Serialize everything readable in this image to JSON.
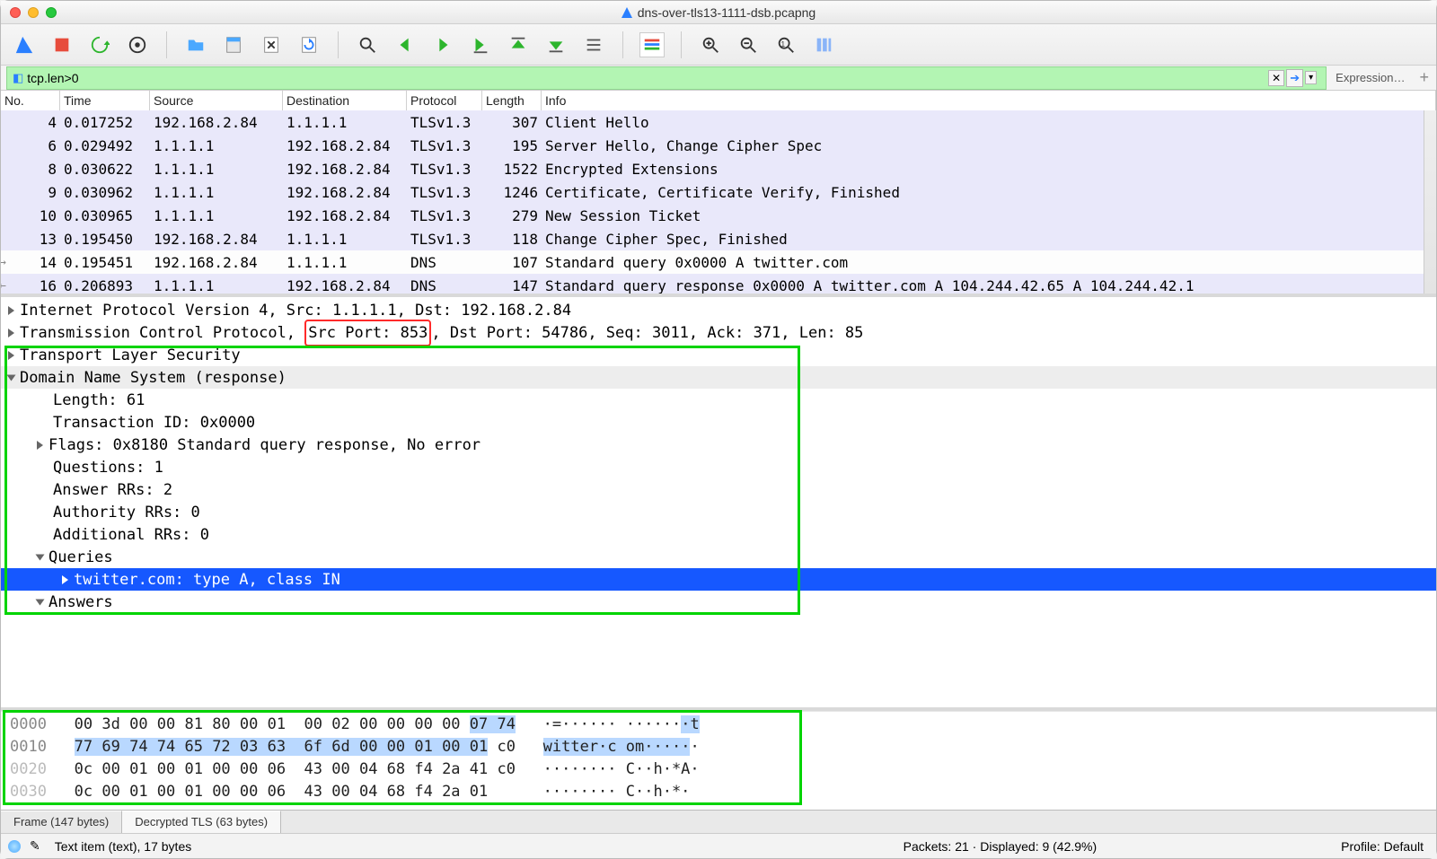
{
  "title": "dns-over-tls13-1111-dsb.pcapng",
  "filter": {
    "value": "tcp.len>0",
    "expression_label": "Expression…"
  },
  "packet_list": {
    "headers": [
      "No.",
      "Time",
      "Source",
      "Destination",
      "Protocol",
      "Length",
      "Info"
    ],
    "rows": [
      {
        "no": "4",
        "time": "0.017252",
        "src": "192.168.2.84",
        "dst": "1.1.1.1",
        "proto": "TLSv1.3",
        "len": "307",
        "info": "Client Hello",
        "cls": ""
      },
      {
        "no": "6",
        "time": "0.029492",
        "src": "1.1.1.1",
        "dst": "192.168.2.84",
        "proto": "TLSv1.3",
        "len": "195",
        "info": "Server Hello, Change Cipher Spec",
        "cls": ""
      },
      {
        "no": "8",
        "time": "0.030622",
        "src": "1.1.1.1",
        "dst": "192.168.2.84",
        "proto": "TLSv1.3",
        "len": "1522",
        "info": "Encrypted Extensions",
        "cls": ""
      },
      {
        "no": "9",
        "time": "0.030962",
        "src": "1.1.1.1",
        "dst": "192.168.2.84",
        "proto": "TLSv1.3",
        "len": "1246",
        "info": "Certificate, Certificate Verify, Finished",
        "cls": ""
      },
      {
        "no": "10",
        "time": "0.030965",
        "src": "1.1.1.1",
        "dst": "192.168.2.84",
        "proto": "TLSv1.3",
        "len": "279",
        "info": "New Session Ticket",
        "cls": ""
      },
      {
        "no": "13",
        "time": "0.195450",
        "src": "192.168.2.84",
        "dst": "1.1.1.1",
        "proto": "TLSv1.3",
        "len": "118",
        "info": "Change Cipher Spec, Finished",
        "cls": ""
      },
      {
        "no": "14",
        "time": "0.195451",
        "src": "192.168.2.84",
        "dst": "1.1.1.1",
        "proto": "DNS",
        "len": "107",
        "info": "Standard query 0x0000 A twitter.com",
        "cls": "white",
        "mark": "→"
      },
      {
        "no": "16",
        "time": "0.206893",
        "src": "1.1.1.1",
        "dst": "192.168.2.84",
        "proto": "DNS",
        "len": "147",
        "info": "Standard query response 0x0000 A twitter.com A 104.244.42.65 A 104.244.42.1",
        "cls": "",
        "mark": "←"
      }
    ]
  },
  "details": {
    "ip_line": "Internet Protocol Version 4, Src: 1.1.1.1, Dst: 192.168.2.84",
    "tcp_pre": "Transmission Control Protocol, ",
    "tcp_hl": "Src Port: 853",
    "tcp_post": ", Dst Port: 54786, Seq: 3011, Ack: 371, Len: 85",
    "tls_line": "Transport Layer Security",
    "dns_line": "Domain Name System (response)",
    "len": "Length: 61",
    "txid": "Transaction ID: 0x0000",
    "flags": "Flags: 0x8180 Standard query response, No error",
    "q": "Questions: 1",
    "arr": "Answer RRs: 2",
    "aurr": "Authority RRs: 0",
    "adrr": "Additional RRs: 0",
    "queries": "Queries",
    "query1": "twitter.com: type A, class IN",
    "answers": "Answers"
  },
  "bytes": {
    "0000": {
      "addr": "0000",
      "pre": "00 3d 00 00 81 80 00 01  00 02 00 00 00 00 ",
      "hl": "07 74",
      "post": "   ·=······ ······",
      "hl2": "·t"
    },
    "0010": {
      "addr": "0010",
      "hl": "77 69 74 74 65 72 03 63  6f 6d 00 00 01 00 01",
      "post": " c0   ",
      "hl2": "witter·c om·····",
      "post2": "·"
    },
    "0020": {
      "addr": "0020",
      "txt": "0c 00 01 00 01 00 00 06  43 00 04 68 f4 2a 41 c0   ········ C··h·*A·"
    },
    "0030": {
      "addr": "0030",
      "txt": "0c 00 01 00 01 00 00 06  43 00 04 68 f4 2a 01      ········ C··h·*· "
    }
  },
  "tabs": {
    "frame": "Frame (147 bytes)",
    "tls": "Decrypted TLS (63 bytes)"
  },
  "status": {
    "sel": "Text item (text), 17 bytes",
    "pk": "Packets: 21 · Displayed: 9 (42.9%)",
    "profile": "Profile: Default"
  }
}
